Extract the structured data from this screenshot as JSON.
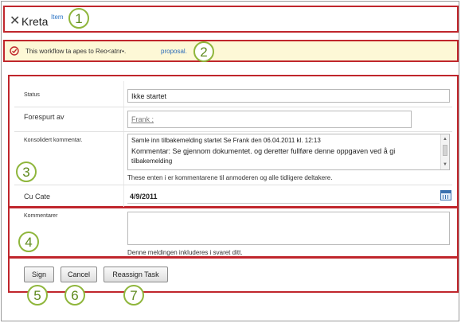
{
  "title": {
    "close_glyph": "✕",
    "name": "Kreta",
    "item_label": "Item"
  },
  "workflow_banner": {
    "message": "This workflow ta apes to Reo<atnr•.",
    "link": "proposal."
  },
  "form": {
    "status": {
      "label": "Status",
      "value": "Ikke startet"
    },
    "requested_by": {
      "label": "Forespurt av",
      "value": "Frank ;"
    },
    "consolidated_comment": {
      "label": "Konsolidert kommentar.",
      "lines": [
        "Samle inn tilbakemelding startet Se Frank den 06.04.2011 kl. 12:13",
        "Kommentar: Se gjennom dokumentet. og deretter fullføre denne oppgaven ved å gi",
        "tilbakemelding"
      ],
      "note": "These  enten i er kommentarene til anmoderen og alle tidligere deltakere."
    },
    "due_date": {
      "label": "Cu Cate",
      "value": "4/9/2011"
    }
  },
  "comments": {
    "label": "Kommentarer",
    "value": "",
    "note": "Denne meldingen inkluderes i svaret ditt."
  },
  "buttons": {
    "sign": "Sign",
    "cancel": "Cancel",
    "reassign": "Reassign Task"
  },
  "callouts": [
    "1",
    "2",
    "3",
    "4",
    "5",
    "6",
    "7"
  ],
  "colors": {
    "region_border": "#c0262c",
    "callout": "#8fb63c",
    "banner_bg": "#fdf8d6",
    "link": "#2a6ab8"
  },
  "icons": {
    "close": "close-icon",
    "workflow": "workflow-icon",
    "calendar": "calendar-icon"
  }
}
